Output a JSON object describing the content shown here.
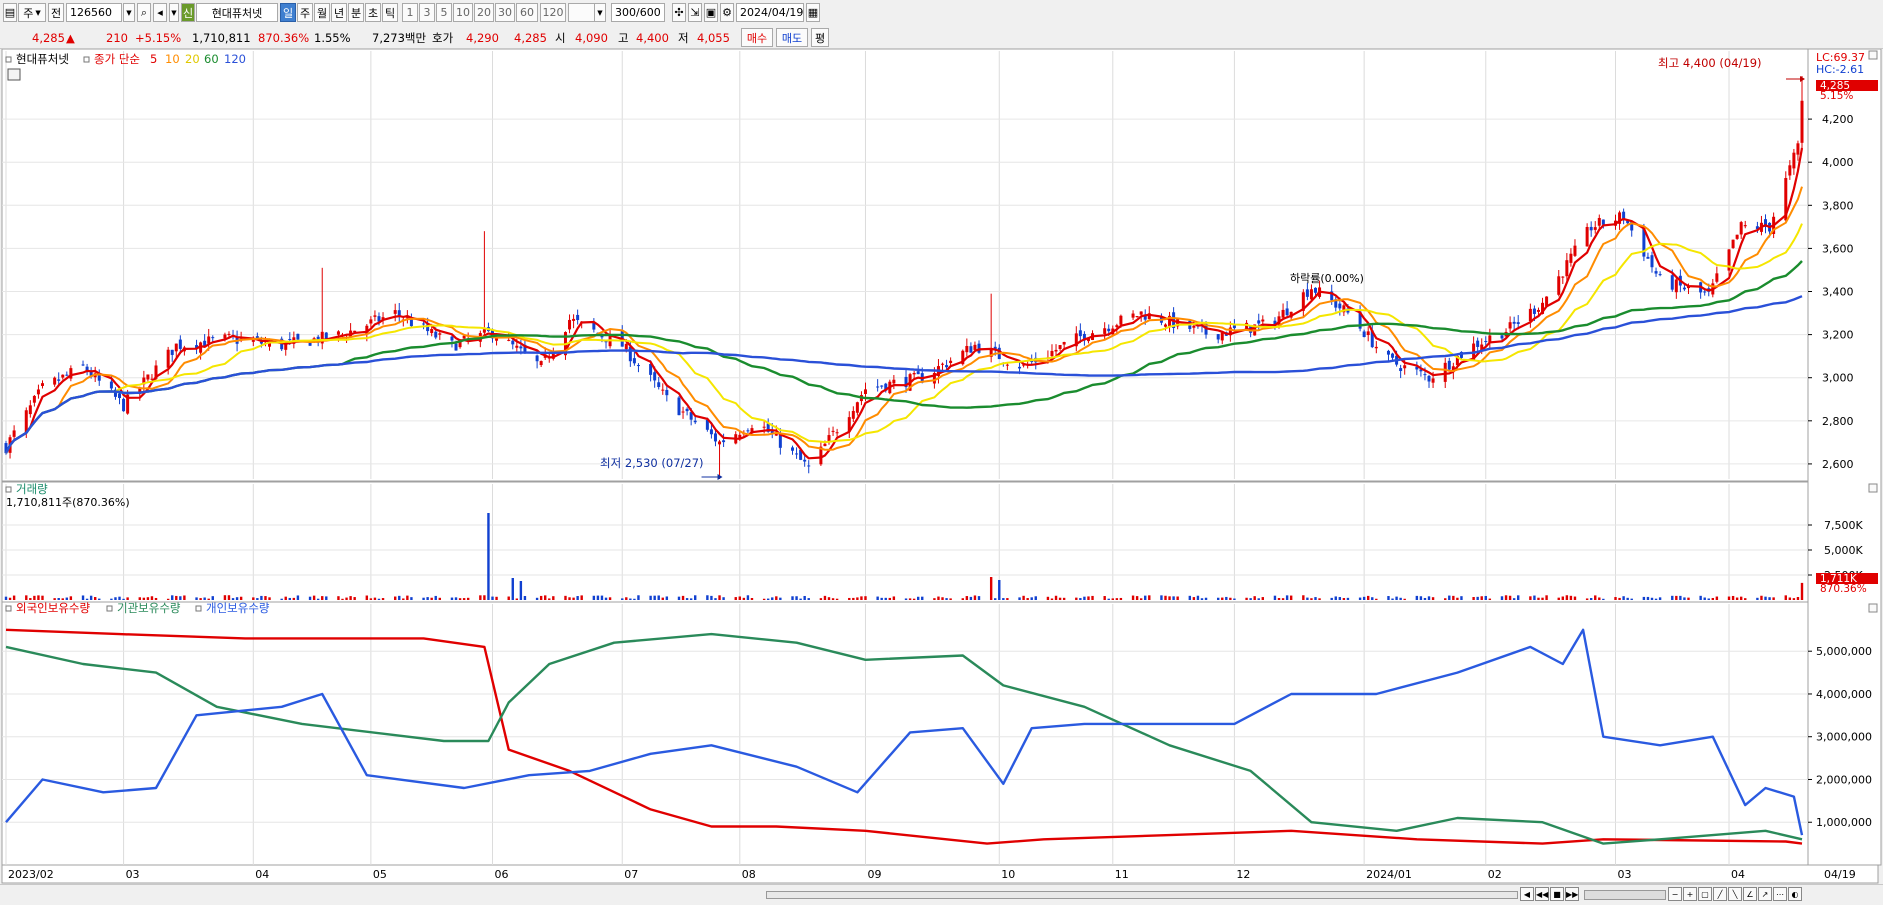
{
  "toolbar": {
    "period_a": "주",
    "market": "전",
    "code": "126560",
    "stock_name": "현대퓨처넷",
    "tabs": [
      "일",
      "주",
      "월",
      "년",
      "분",
      "초",
      "틱"
    ],
    "selected_tab": "일",
    "intervals": [
      "1",
      "3",
      "5",
      "10",
      "20",
      "30",
      "60",
      "120"
    ],
    "count": "300",
    "count_max": "/600",
    "date": "2024/04/19"
  },
  "quote": {
    "price": "4,285",
    "arrow": "▲",
    "change": "210",
    "change_pct": "+5.15%",
    "volume": "1,710,811",
    "volume_ratio": "870.36%",
    "turnover": "1.55%",
    "amount": "7,273백만",
    "hoga_label": "호가",
    "ask": "4,290",
    "bid": "4,285",
    "open_label": "시",
    "open": "4,090",
    "high_label": "고",
    "high": "4,400",
    "low_label": "저",
    "low": "4,055",
    "buy_label": "매수",
    "sell_label": "매도",
    "eval_label": "평"
  },
  "legend": {
    "stock": "현대퓨처넷",
    "ma_label": "종가 단순",
    "ma_periods": [
      "5",
      "10",
      "20",
      "60",
      "120"
    ]
  },
  "price_panel": {
    "lc": "LC:69.37",
    "hc": "HC:-2.61",
    "high_note": "최고 4,400 (04/19)",
    "low_note": "최저 2,530 (07/27)",
    "drop_note": "하락률(0.00%)",
    "last_price": "4,285",
    "last_pct": "5.15%"
  },
  "volume_panel": {
    "title": "거래량",
    "info": "1,710,811주(870.36%)",
    "last_vol": "1,711K",
    "last_pct": "870.36%"
  },
  "holding_panel": {
    "legend": [
      "외국인보유수량",
      "기관보유수량",
      "개인보유수량"
    ]
  },
  "colors": {
    "ma5": "#e00000",
    "ma10": "#ff8c00",
    "ma20": "#f5e600",
    "ma60": "#1a8c2e",
    "ma120": "#2a50d8",
    "up": "#e00000",
    "down": "#1040d0",
    "foreign": "#e00000",
    "institution": "#2a8a5a",
    "individual": "#2a5ae0"
  },
  "chart_data": [
    {
      "type": "candlestick",
      "title": "",
      "xlabel": "",
      "ylabel": "",
      "x_ticks": [
        "2023/02",
        "03",
        "04",
        "05",
        "06",
        "07",
        "08",
        "09",
        "10",
        "11",
        "12",
        "2024/01",
        "02",
        "03",
        "04",
        "04/19"
      ],
      "ylim": [
        2530,
        4400
      ],
      "y_ticks": [
        2600,
        2800,
        3000,
        3200,
        3400,
        3600,
        3800,
        4000,
        4200
      ],
      "close_anchors": [
        [
          "2023/02/01",
          2680
        ],
        [
          "2023/02/10",
          2950
        ],
        [
          "2023/02/20",
          3050
        ],
        [
          "2023/03/02",
          2870
        ],
        [
          "2023/03/15",
          3150
        ],
        [
          "2023/03/28",
          3180
        ],
        [
          "2023/04/10",
          3150
        ],
        [
          "2023/04/25",
          3200
        ],
        [
          "2023/05/08",
          3300
        ],
        [
          "2023/05/22",
          3150
        ],
        [
          "2023/06/01",
          3210
        ],
        [
          "2023/06/13",
          3050
        ],
        [
          "2023/06/20",
          3270
        ],
        [
          "2023/07/03",
          3150
        ],
        [
          "2023/07/14",
          2900
        ],
        [
          "2023/07/27",
          2700
        ],
        [
          "2023/08/05",
          2800
        ],
        [
          "2023/08/18",
          2580
        ],
        [
          "2023/09/01",
          2950
        ],
        [
          "2023/09/15",
          3000
        ],
        [
          "2023/09/28",
          3150
        ],
        [
          "2023/10/10",
          3050
        ],
        [
          "2023/10/25",
          3200
        ],
        [
          "2023/11/08",
          3300
        ],
        [
          "2023/11/25",
          3200
        ],
        [
          "2023/12/10",
          3250
        ],
        [
          "2023/12/20",
          3420
        ],
        [
          "2023/12/29",
          3300
        ],
        [
          "2024/01/08",
          3080
        ],
        [
          "2024/01/18",
          3000
        ],
        [
          "2024/01/29",
          3150
        ],
        [
          "2024/02/07",
          3230
        ],
        [
          "2024/02/15",
          3350
        ],
        [
          "2024/02/27",
          3700
        ],
        [
          "2024/03/06",
          3750
        ],
        [
          "2024/03/15",
          3450
        ],
        [
          "2024/03/27",
          3380
        ],
        [
          "2024/04/04",
          3700
        ],
        [
          "2024/04/11",
          3700
        ],
        [
          "2024/04/18",
          4075
        ],
        [
          "2024/04/19",
          4285
        ]
      ],
      "series": [
        {
          "name": "5",
          "kind": "ma",
          "period": 5
        },
        {
          "name": "10",
          "kind": "ma",
          "period": 10
        },
        {
          "name": "20",
          "kind": "ma",
          "period": 20
        },
        {
          "name": "60",
          "kind": "ma",
          "period": 60
        },
        {
          "name": "120",
          "kind": "ma",
          "period": 120
        }
      ],
      "high": {
        "date": "2024/04/19",
        "value": 4400
      },
      "low": {
        "date": "2023/07/27",
        "value": 2530
      },
      "last": {
        "date": "2024/04/19",
        "open": 4090,
        "high": 4400,
        "low": 4055,
        "close": 4285
      }
    },
    {
      "type": "bar",
      "title": "",
      "ylim": [
        0,
        9000000
      ],
      "y_ticks": [
        2500000,
        5000000,
        7500000
      ],
      "y_tick_labels": [
        "2,500K",
        "5,000K",
        "7,500K"
      ],
      "spikes": [
        [
          "2023/05/31",
          8700000
        ],
        [
          "2023/06/06",
          2200000
        ],
        [
          "2023/06/08",
          1900000
        ],
        [
          "2023/10/02",
          2300000
        ],
        [
          "2023/10/04",
          2000000
        ],
        [
          "2024/04/19",
          1711000
        ]
      ],
      "base_volume": 400000
    },
    {
      "type": "line",
      "title": "",
      "ylim": [
        0,
        5800000
      ],
      "y_ticks": [
        1000000,
        2000000,
        3000000,
        4000000,
        5000000
      ],
      "y_tick_labels": [
        "1,000,000",
        "2,000,000",
        "3,000,000",
        "4,000,000",
        "5,000,000"
      ],
      "series": [
        {
          "name": "외국인보유수량",
          "points": [
            [
              "2023/02/01",
              5500000
            ],
            [
              "2023/03/01",
              5400000
            ],
            [
              "2023/04/01",
              5300000
            ],
            [
              "2023/05/15",
              5300000
            ],
            [
              "2023/05/30",
              5100000
            ],
            [
              "2023/06/05",
              2700000
            ],
            [
              "2023/06/20",
              2200000
            ],
            [
              "2023/07/10",
              1300000
            ],
            [
              "2023/07/25",
              900000
            ],
            [
              "2023/08/10",
              900000
            ],
            [
              "2023/09/01",
              800000
            ],
            [
              "2023/10/01",
              500000
            ],
            [
              "2023/10/15",
              600000
            ],
            [
              "2023/11/15",
              700000
            ],
            [
              "2023/12/15",
              800000
            ],
            [
              "2024/01/15",
              600000
            ],
            [
              "2024/02/15",
              500000
            ],
            [
              "2024/03/01",
              600000
            ],
            [
              "2024/04/15",
              550000
            ],
            [
              "2024/04/19",
              500000
            ]
          ]
        },
        {
          "name": "기관보유수량",
          "points": [
            [
              "2023/02/01",
              5100000
            ],
            [
              "2023/02/20",
              4700000
            ],
            [
              "2023/03/10",
              4500000
            ],
            [
              "2023/03/25",
              3700000
            ],
            [
              "2023/04/15",
              3300000
            ],
            [
              "2023/05/20",
              2900000
            ],
            [
              "2023/05/31",
              2900000
            ],
            [
              "2023/06/05",
              3800000
            ],
            [
              "2023/06/15",
              4700000
            ],
            [
              "2023/07/01",
              5200000
            ],
            [
              "2023/07/25",
              5400000
            ],
            [
              "2023/08/15",
              5200000
            ],
            [
              "2023/09/01",
              4800000
            ],
            [
              "2023/09/25",
              4900000
            ],
            [
              "2023/10/05",
              4200000
            ],
            [
              "2023/10/25",
              3700000
            ],
            [
              "2023/11/15",
              2800000
            ],
            [
              "2023/12/05",
              2200000
            ],
            [
              "2023/12/20",
              1000000
            ],
            [
              "2024/01/10",
              800000
            ],
            [
              "2024/01/25",
              1100000
            ],
            [
              "2024/02/15",
              1000000
            ],
            [
              "2024/03/01",
              500000
            ],
            [
              "2024/03/15",
              600000
            ],
            [
              "2024/04/10",
              800000
            ],
            [
              "2024/04/19",
              600000
            ]
          ]
        },
        {
          "name": "개인보유수량",
          "points": [
            [
              "2023/02/01",
              1000000
            ],
            [
              "2023/02/10",
              2000000
            ],
            [
              "2023/02/25",
              1700000
            ],
            [
              "2023/03/10",
              1800000
            ],
            [
              "2023/03/20",
              3500000
            ],
            [
              "2023/04/10",
              3700000
            ],
            [
              "2023/04/20",
              4000000
            ],
            [
              "2023/05/01",
              2100000
            ],
            [
              "2023/05/25",
              1800000
            ],
            [
              "2023/06/10",
              2100000
            ],
            [
              "2023/06/25",
              2200000
            ],
            [
              "2023/07/10",
              2600000
            ],
            [
              "2023/07/25",
              2800000
            ],
            [
              "2023/08/15",
              2300000
            ],
            [
              "2023/08/30",
              1700000
            ],
            [
              "2023/09/12",
              3100000
            ],
            [
              "2023/09/25",
              3200000
            ],
            [
              "2023/10/05",
              1900000
            ],
            [
              "2023/10/12",
              3200000
            ],
            [
              "2023/10/25",
              3300000
            ],
            [
              "2023/11/10",
              3300000
            ],
            [
              "2023/12/01",
              3300000
            ],
            [
              "2023/12/15",
              4000000
            ],
            [
              "2024/01/05",
              4000000
            ],
            [
              "2024/01/25",
              4500000
            ],
            [
              "2024/02/12",
              5100000
            ],
            [
              "2024/02/20",
              4700000
            ],
            [
              "2024/02/25",
              5500000
            ],
            [
              "2024/03/01",
              3000000
            ],
            [
              "2024/03/15",
              2800000
            ],
            [
              "2024/03/28",
              3000000
            ],
            [
              "2024/04/05",
              1400000
            ],
            [
              "2024/04/10",
              1800000
            ],
            [
              "2024/04/17",
              1600000
            ],
            [
              "2024/04/19",
              700000
            ]
          ]
        }
      ]
    }
  ]
}
